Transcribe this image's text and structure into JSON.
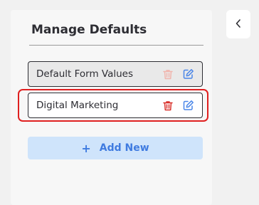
{
  "panel": {
    "title": "Manage Defaults",
    "items": [
      {
        "label": "Default Form Values",
        "delete_icon": "trash-icon",
        "edit_icon": "edit-icon",
        "delete_enabled": false
      },
      {
        "label": "Digital Marketing",
        "delete_icon": "trash-icon",
        "edit_icon": "edit-icon",
        "delete_enabled": true
      }
    ],
    "add_button": {
      "icon": "+",
      "label": "Add New"
    }
  },
  "collapse_button": {
    "icon": "chevron-left-icon"
  },
  "colors": {
    "delete_disabled": "#f1b5ad",
    "delete_enabled": "#d9302a",
    "edit": "#4a86e8",
    "highlight": "#e02020",
    "add_text": "#3f7be0"
  }
}
